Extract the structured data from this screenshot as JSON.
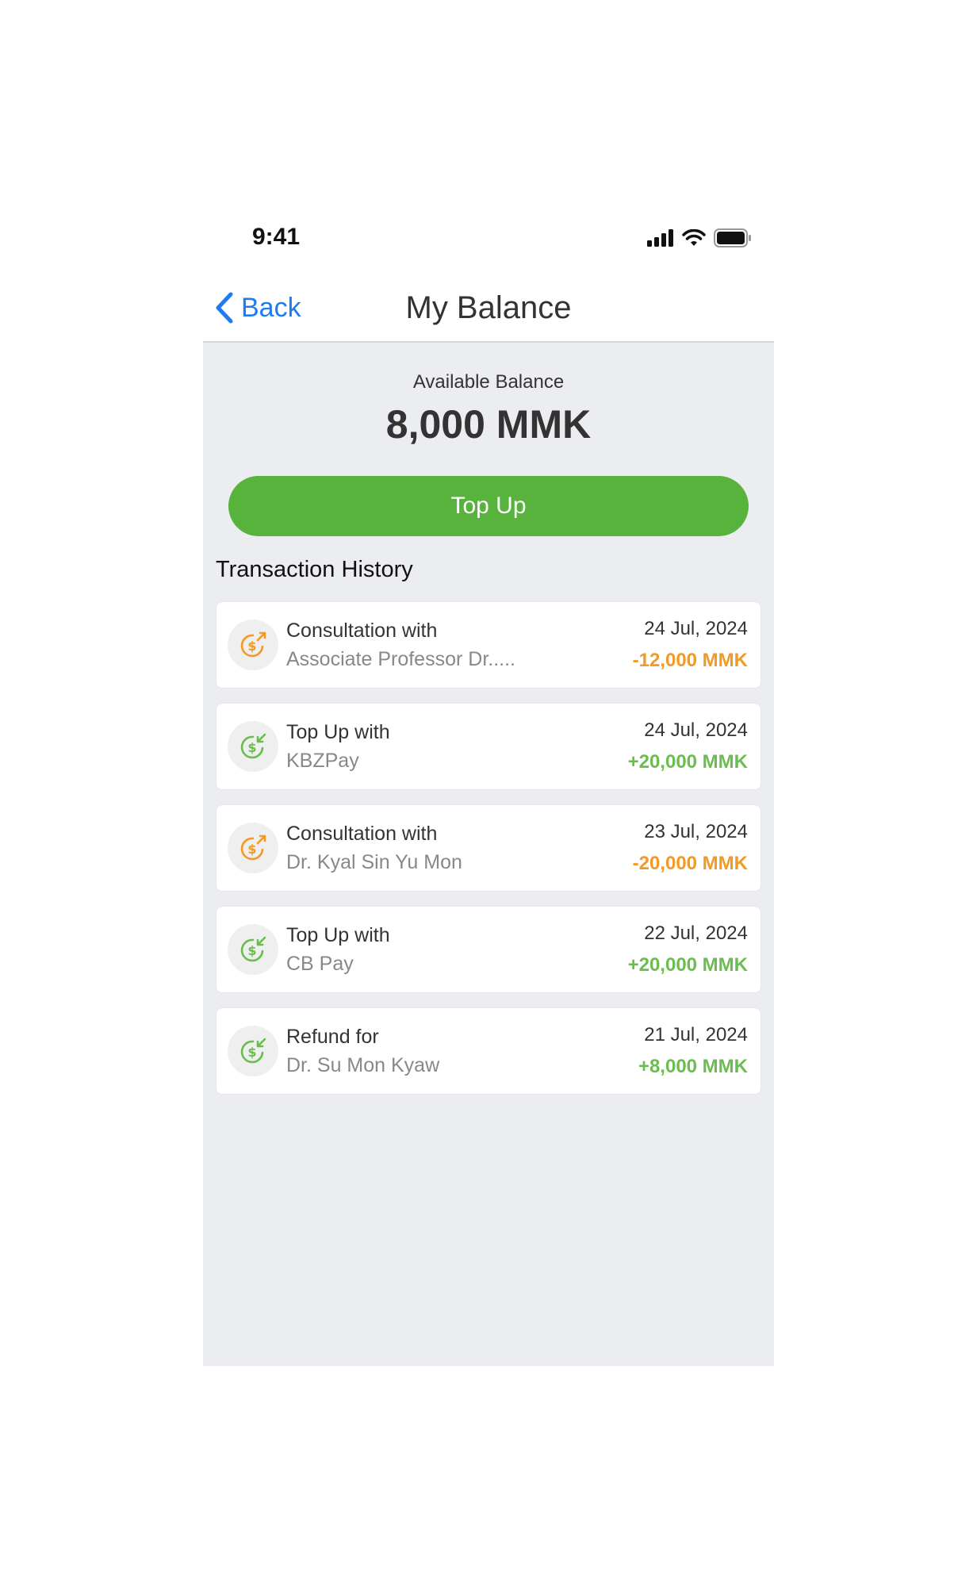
{
  "status_bar": {
    "time": "9:41"
  },
  "nav": {
    "back_label": "Back",
    "title": "My Balance"
  },
  "balance": {
    "label": "Available Balance",
    "amount": "8,000 MMK"
  },
  "actions": {
    "top_up_label": "Top Up"
  },
  "history": {
    "title": "Transaction History",
    "items": [
      {
        "type": "debit",
        "title": "Consultation with",
        "subtitle": "Associate Professor Dr.....",
        "date": "24 Jul, 2024",
        "amount": "-12,000 MMK"
      },
      {
        "type": "credit",
        "title": "Top Up with",
        "subtitle": "KBZPay",
        "date": "24 Jul, 2024",
        "amount": "+20,000 MMK"
      },
      {
        "type": "debit",
        "title": "Consultation with",
        "subtitle": "Dr. Kyal Sin Yu Mon",
        "date": "23 Jul, 2024",
        "amount": "-20,000 MMK"
      },
      {
        "type": "credit",
        "title": "Top Up with",
        "subtitle": "CB Pay",
        "date": "22 Jul, 2024",
        "amount": "+20,000 MMK"
      },
      {
        "type": "credit",
        "title": "Refund for",
        "subtitle": "Dr. Su Mon Kyaw",
        "date": "21 Jul, 2024",
        "amount": "+8,000 MMK"
      }
    ]
  },
  "colors": {
    "accent_blue": "#1f7cf0",
    "top_up_green": "#58b33c",
    "debit_orange": "#f29a24",
    "credit_green": "#6bbd4f",
    "content_background": "#ecedf1"
  },
  "icons": {
    "back": "chevron-left-icon",
    "signal": "cellular-signal-icon",
    "wifi": "wifi-icon",
    "battery": "battery-icon",
    "debit": "money-outgoing-icon",
    "credit": "money-incoming-icon"
  }
}
